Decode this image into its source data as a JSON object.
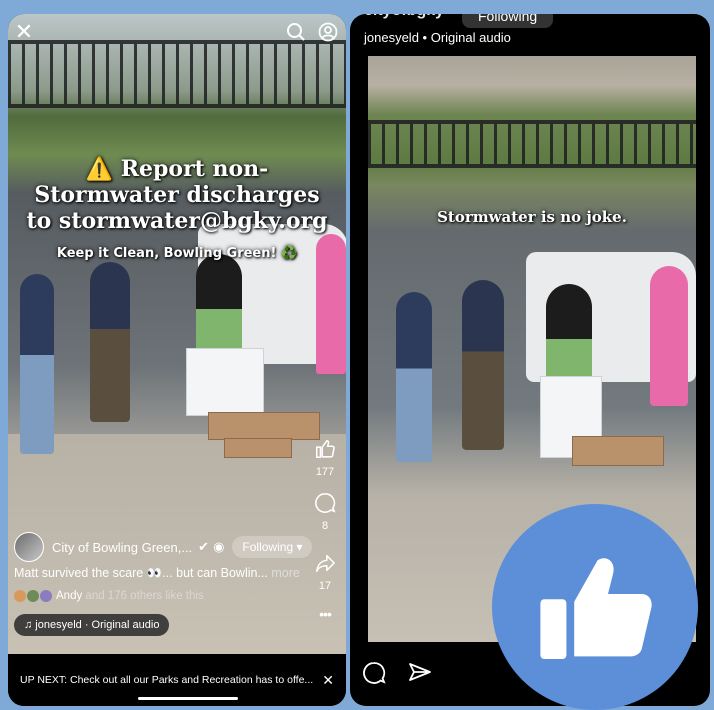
{
  "left": {
    "headline": "⚠️ Report non-Stormwater discharges to stormwater@bgky.org",
    "subline": "Keep it Clean, Bowling Green! ♻️",
    "like_count": "177",
    "comment_count": "8",
    "share_count": "17",
    "more_glyph": "•••",
    "channel_name": "City of Bowling Green,...",
    "follow_label": "Following",
    "caption_text": "Matt survived the scare 👀... but can Bowlin...",
    "caption_more": "more",
    "likes_name": "Andy",
    "likes_rest": "and 176 others like this",
    "audio_label": "♫ jonesyeld · Original audio",
    "upnext_text": "UP NEXT: Check out all our Parks and Recreation has to offe...",
    "upnext_close": "✕"
  },
  "right": {
    "title": "cityofbgky",
    "follow_label": "Following",
    "subline": "jonesyeld • Original audio",
    "overlay": "Stormwater is no joke."
  },
  "colors": {
    "background": "#7fa9d6",
    "thumbs_badge": "#5d8fd8"
  }
}
